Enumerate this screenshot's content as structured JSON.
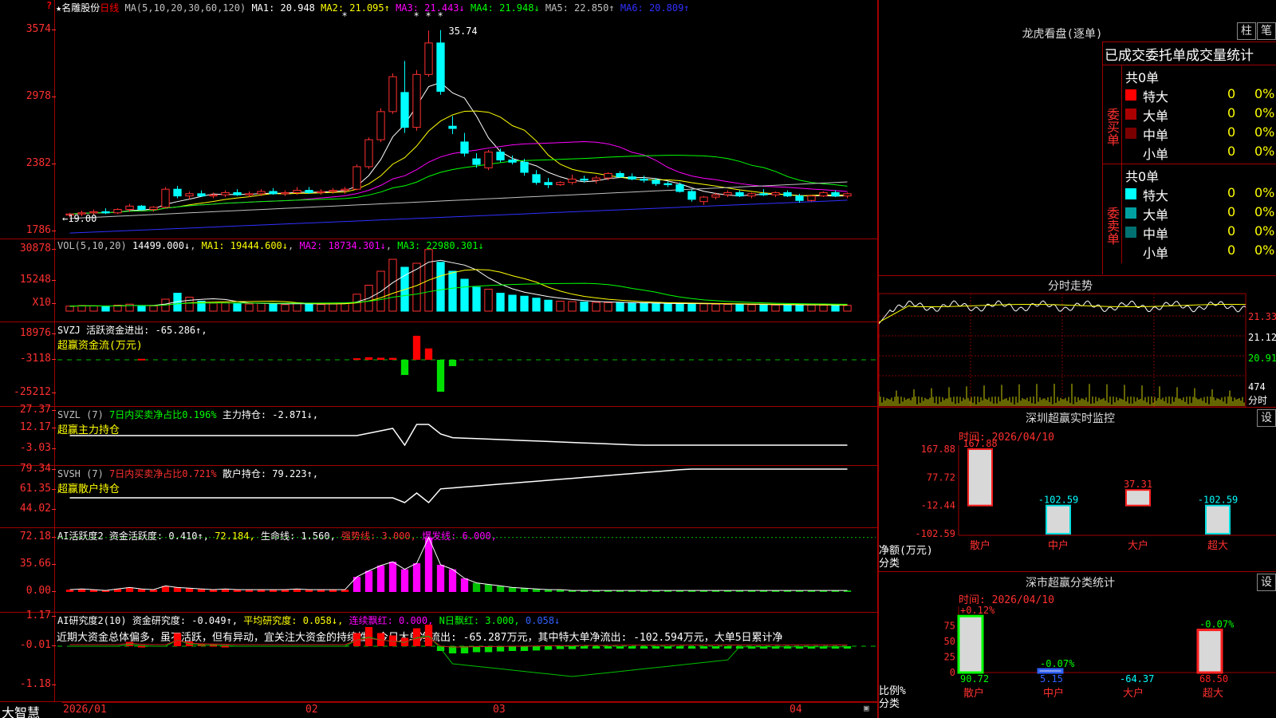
{
  "title_bar": {
    "name": "★名雕股份",
    "period": "日线",
    "corner_mark": "?"
  },
  "main": {
    "ma_label": "MA(5,10,20,30,60,120)",
    "ma": [
      {
        "label": "MA1: 20.948",
        "color": "#ffffff",
        "arrow": ""
      },
      {
        "label": "MA2: 21.095↑",
        "color": "#ffff00",
        "arrow": ""
      },
      {
        "label": "MA3: 21.443↓",
        "color": "#ff00ff",
        "arrow": ""
      },
      {
        "label": "MA4: 21.948↓",
        "color": "#00ff00",
        "arrow": ""
      },
      {
        "label": "MA5: 22.850↑",
        "color": "#c0c0c0",
        "arrow": ""
      },
      {
        "label": "MA6: 20.809↑",
        "color": "#3030ff",
        "arrow": ""
      }
    ],
    "y_labels": [
      "3574",
      "2978",
      "2382",
      "1786"
    ],
    "y_values": [
      35.74,
      29.78,
      23.82,
      17.86
    ],
    "high_note": "35.74",
    "low_note": "←19.00",
    "price_range": [
      17.5,
      37
    ]
  },
  "volume": {
    "header": "VOL(5,10,20)",
    "vol": "14499.000↓",
    "ma1": "MA1: 19444.600↓",
    "ma2": "MA2: 18734.301↓",
    "ma3": "MA3: 22980.301↓",
    "y_labels": [
      "30878",
      "15248",
      "X10"
    ]
  },
  "svzj": {
    "header": "SVZJ  活跃资金进出: -65.286↑,",
    "sub": "超赢资金流(万元)",
    "y_labels": [
      "18976",
      "-3118",
      "-25212"
    ]
  },
  "svzl": {
    "header_a": "SVZL (7)",
    "header_b": "7日内买卖净占比0.196%",
    "header_c": "主力持仓: -2.871↓,",
    "sub": "超赢主力持仓",
    "y_labels": [
      "27.37",
      "12.17",
      "-3.03"
    ]
  },
  "svsh": {
    "header_a": "SVSH (7)",
    "header_b": "7日内买卖净占比0.721%",
    "header_c": "散户持仓: 79.223↑,",
    "sub": "超赢散户持仓",
    "y_labels": [
      "79.34",
      "61.35",
      "44.02"
    ]
  },
  "ai_active": {
    "header_a": "AI活跃度2",
    "header_b": "资金活跃度: 0.410↑,",
    "header_c": "72.184,",
    "header_d": "生命线: 1.560,",
    "header_e": "强势线: 3.000,",
    "header_f": "爆发线: 6.000,",
    "y_labels": [
      "72.18",
      "35.66",
      "0.00"
    ]
  },
  "ai_research": {
    "header_a": "AI研究度2(10)",
    "header_b": "资金研究度: -0.049↑,",
    "header_c": "平均研究度: 0.058↓,",
    "header_d": "连续飘红: 0.000,",
    "header_e": "N日飘红: 3.000,",
    "header_f": "0.058↓",
    "summary": "近期大资金总体偏多，虽不活跃，但有异动，宜关注大资金的持续性，今日大单净流出: -65.287万元，其中特大单净流出: -102.594万元，大单5日累计净",
    "y_labels": [
      "1.17",
      "-0.01",
      "-1.18"
    ]
  },
  "date_axis": {
    "brand": "大智慧",
    "labels": [
      "2026/01",
      "02",
      "03",
      "04"
    ]
  },
  "longhu": {
    "title": "龙虎看盘(逐单)",
    "btn1": "柱",
    "btn2": "笔",
    "table_title": "已成交委托单成交量统计",
    "buy": {
      "side": "委买单",
      "count": "共0单",
      "rows": [
        {
          "name": "特大",
          "val": "0",
          "pct": "0%",
          "color": "#ff0000"
        },
        {
          "name": "大单",
          "val": "0",
          "pct": "0%",
          "color": "#aa0000"
        },
        {
          "name": "中单",
          "val": "0",
          "pct": "0%",
          "color": "#7a0000"
        },
        {
          "name": "小单",
          "val": "0",
          "pct": "0%",
          "color": ""
        }
      ]
    },
    "sell": {
      "side": "委卖单",
      "count": "共0单",
      "rows": [
        {
          "name": "特大",
          "val": "0",
          "pct": "0%",
          "color": "#00ffff"
        },
        {
          "name": "大单",
          "val": "0",
          "pct": "0%",
          "color": "#00a0a0"
        },
        {
          "name": "中单",
          "val": "0",
          "pct": "0%",
          "color": "#007070"
        },
        {
          "name": "小单",
          "val": "0",
          "pct": "0%",
          "color": ""
        }
      ]
    }
  },
  "intraday": {
    "title": "分时走势",
    "y_labels": [
      "21.33",
      "21.12",
      "20.91"
    ],
    "vol_label": "474",
    "unit": "分时"
  },
  "sz_monitor": {
    "title": "深圳超赢实时监控",
    "btn": "设",
    "time": "时间: 2026/04/10",
    "y_labels": [
      "167.88",
      "77.72",
      "-12.44",
      "-102.59"
    ],
    "y_unit": "净额(万元)",
    "x_unit": "分类",
    "bars": [
      {
        "cat": "散户",
        "val": 167.88,
        "label": "167.88"
      },
      {
        "cat": "中户",
        "val": -102.59,
        "label": "-102.59"
      },
      {
        "cat": "大户",
        "val": 37.31,
        "label": "37.31"
      },
      {
        "cat": "超大",
        "val": -102.59,
        "label": "-102.59"
      }
    ]
  },
  "sz_class": {
    "title": "深市超赢分类统计",
    "btn": "设",
    "time": "时间: 2026/04/10",
    "y_labels": [
      "75",
      "50",
      "25",
      "0"
    ],
    "y_unit": "比例%",
    "x_unit": "分类",
    "bars": [
      {
        "cat": "散户",
        "val": 90.72,
        "top": "+0.12%",
        "bottom": "90.72"
      },
      {
        "cat": "中户",
        "val": 5.15,
        "top": "-0.07%",
        "bottom": "5.15"
      },
      {
        "cat": "大户",
        "val": 0,
        "top": "",
        "bottom": "-64.37"
      },
      {
        "cat": "超大",
        "val": 68.5,
        "top": "-0.07%",
        "bottom": "68.50"
      }
    ]
  },
  "chart_data": {
    "type": "candlestick",
    "candles": [
      [
        19.3,
        19.5,
        19.1,
        19.4
      ],
      [
        19.4,
        19.7,
        19.2,
        19.5
      ],
      [
        19.5,
        19.8,
        19.3,
        19.6
      ],
      [
        19.6,
        19.9,
        19.4,
        19.5
      ],
      [
        19.5,
        19.9,
        19.4,
        19.8
      ],
      [
        19.8,
        20.3,
        19.6,
        20.1
      ],
      [
        20.1,
        20.2,
        19.7,
        19.8
      ],
      [
        19.8,
        20.1,
        19.6,
        20.0
      ],
      [
        20.0,
        21.8,
        19.9,
        21.6
      ],
      [
        21.6,
        21.9,
        20.8,
        21.0
      ],
      [
        21.0,
        21.4,
        20.7,
        21.2
      ],
      [
        21.2,
        21.5,
        20.9,
        21.0
      ],
      [
        21.0,
        21.3,
        20.8,
        21.1
      ],
      [
        21.1,
        21.5,
        20.9,
        21.3
      ],
      [
        21.3,
        21.6,
        21.0,
        21.1
      ],
      [
        21.1,
        21.4,
        20.9,
        21.2
      ],
      [
        21.2,
        21.6,
        21.0,
        21.4
      ],
      [
        21.4,
        21.7,
        21.1,
        21.2
      ],
      [
        21.2,
        21.5,
        21.0,
        21.3
      ],
      [
        21.3,
        21.8,
        21.1,
        21.5
      ],
      [
        21.5,
        21.8,
        21.2,
        21.3
      ],
      [
        21.3,
        21.6,
        21.1,
        21.4
      ],
      [
        21.4,
        21.7,
        21.2,
        21.5
      ],
      [
        21.5,
        21.8,
        21.2,
        21.6
      ],
      [
        21.6,
        23.8,
        21.5,
        23.6
      ],
      [
        23.6,
        26.2,
        23.4,
        26.0
      ],
      [
        26.0,
        28.8,
        25.8,
        28.5
      ],
      [
        28.5,
        31.9,
        28.3,
        31.6
      ],
      [
        30.2,
        33.0,
        26.6,
        27.1
      ],
      [
        27.1,
        32.2,
        26.8,
        31.8
      ],
      [
        31.8,
        35.7,
        31.6,
        34.6
      ],
      [
        34.6,
        35.74,
        30.0,
        30.3
      ],
      [
        27.2,
        28.1,
        26.5,
        27.0
      ],
      [
        25.8,
        26.6,
        24.5,
        24.8
      ],
      [
        24.3,
        24.8,
        23.5,
        23.8
      ],
      [
        23.5,
        25.1,
        23.3,
        24.9
      ],
      [
        24.9,
        25.2,
        24.0,
        24.2
      ],
      [
        24.2,
        24.6,
        23.8,
        24.0
      ],
      [
        24.0,
        24.3,
        22.8,
        23.1
      ],
      [
        22.9,
        23.3,
        22.0,
        22.2
      ],
      [
        22.2,
        22.6,
        21.7,
        22.0
      ],
      [
        22.0,
        22.3,
        21.9,
        22.2
      ],
      [
        22.2,
        22.9,
        22.0,
        22.5
      ],
      [
        22.5,
        22.8,
        22.2,
        22.4
      ],
      [
        22.4,
        22.8,
        22.1,
        22.6
      ],
      [
        22.6,
        23.1,
        22.4,
        23.0
      ],
      [
        23.0,
        23.2,
        22.6,
        22.7
      ],
      [
        22.7,
        23.0,
        22.4,
        22.5
      ],
      [
        22.5,
        22.8,
        22.2,
        22.4
      ],
      [
        22.4,
        22.6,
        21.9,
        22.1
      ],
      [
        22.1,
        22.3,
        21.8,
        22.0
      ],
      [
        22.0,
        22.2,
        21.3,
        21.4
      ],
      [
        21.4,
        21.6,
        20.5,
        20.7
      ],
      [
        20.5,
        21.0,
        20.2,
        20.9
      ],
      [
        20.9,
        21.3,
        20.7,
        21.1
      ],
      [
        21.1,
        21.5,
        20.9,
        21.3
      ],
      [
        21.3,
        21.5,
        20.9,
        21.0
      ],
      [
        21.0,
        21.3,
        20.8,
        21.2
      ],
      [
        21.2,
        21.6,
        21.0,
        21.1
      ],
      [
        21.1,
        21.4,
        20.9,
        21.3
      ],
      [
        21.3,
        21.5,
        20.9,
        21.0
      ],
      [
        21.0,
        21.2,
        20.4,
        20.6
      ],
      [
        20.6,
        21.1,
        20.5,
        21.0
      ],
      [
        21.0,
        21.4,
        20.9,
        21.3
      ],
      [
        21.3,
        21.5,
        20.9,
        21.0
      ],
      [
        21.0,
        21.3,
        20.8,
        21.2
      ]
    ],
    "volume": [
      2500,
      2800,
      2600,
      2400,
      3000,
      3500,
      2700,
      2600,
      6000,
      9000,
      7000,
      5000,
      4000,
      4200,
      3800,
      3600,
      4000,
      3500,
      3300,
      4100,
      3700,
      3400,
      3600,
      3900,
      8500,
      13000,
      20000,
      26000,
      22000,
      24000,
      30878,
      24500,
      20000,
      16000,
      12000,
      11000,
      9000,
      8000,
      7500,
      6500,
      5500,
      5000,
      4800,
      4600,
      4400,
      4300,
      4200,
      4000,
      3900,
      3800,
      3700,
      3600,
      3900,
      3700,
      3500,
      3400,
      3300,
      3200,
      3300,
      3100,
      3000,
      3200,
      3100,
      3000,
      2950,
      2900
    ],
    "svzj": [
      0,
      0,
      0,
      0,
      0,
      0,
      800,
      0,
      0,
      0,
      0,
      0,
      0,
      0,
      0,
      0,
      0,
      0,
      0,
      0,
      0,
      0,
      0,
      0,
      1200,
      2000,
      1600,
      1500,
      -12000,
      18976,
      9000,
      -25212,
      -5000,
      0,
      0,
      0,
      0,
      0,
      0,
      0,
      0,
      0,
      0,
      0,
      0,
      0,
      0,
      0,
      0,
      0,
      0,
      0,
      0,
      0,
      0,
      0,
      0,
      0,
      0,
      0,
      0,
      0,
      0,
      0,
      0,
      0
    ],
    "ai_active": [
      3,
      4,
      3,
      2,
      4,
      6,
      4,
      3,
      8,
      6,
      5,
      4,
      3,
      4,
      3,
      3,
      3,
      3,
      3,
      4,
      3,
      3,
      3,
      3,
      20,
      28,
      35,
      40,
      30,
      38,
      72.18,
      36,
      30,
      18,
      12,
      10,
      8,
      6,
      5,
      4,
      3,
      3,
      2,
      2,
      2,
      2,
      2,
      2,
      2,
      2,
      2,
      2,
      2,
      2,
      2,
      2,
      2,
      2,
      2,
      2,
      2,
      2,
      2,
      2,
      2,
      2
    ],
    "ai_research": [
      0,
      0,
      0,
      0,
      0,
      0.18,
      0.05,
      0,
      0,
      0.55,
      0.2,
      0.1,
      0.08,
      0.05,
      0,
      0,
      0,
      0,
      0,
      0,
      0,
      0,
      0,
      0,
      0.55,
      0.8,
      0.55,
      0.45,
      0.35,
      0.75,
      0.9,
      -0.2,
      -0.3,
      -0.3,
      -0.25,
      -0.25,
      -0.22,
      -0.2,
      -0.2,
      -0.18,
      -0.15,
      -0.12,
      -0.12,
      -0.1,
      -0.1,
      -0.1,
      -0.08,
      -0.08,
      -0.08,
      -0.06,
      -0.06,
      -0.06,
      -0.05,
      -0.05,
      -0.05,
      -0.05,
      -0.05,
      -0.05,
      -0.05,
      -0.05,
      -0.05,
      -0.05,
      -0.05,
      -0.05,
      -0.05,
      -0.05
    ]
  }
}
